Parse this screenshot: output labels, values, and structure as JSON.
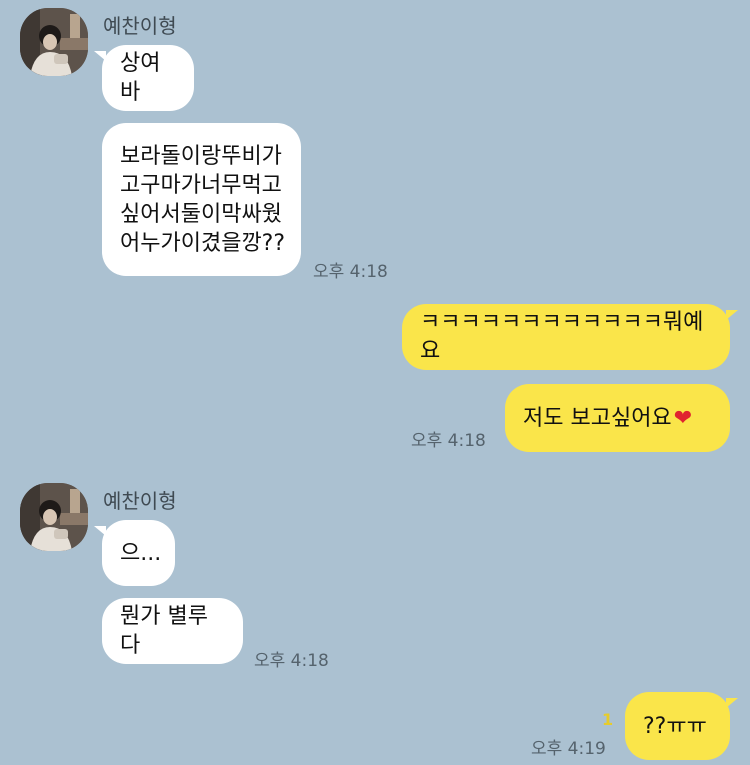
{
  "messages": {
    "sender_name": "예찬이형",
    "group1": {
      "msg1": "상여바",
      "msg2": "보라돌이랑뚜비가\n고구마가너무먹고\n싶어서둘이막싸웠\n어누가이겼을깡??",
      "time": "오후 4:18"
    },
    "mine1": {
      "msg1": "ㅋㅋㅋㅋㅋㅋㅋㅋㅋㅋㅋㅋ뭐예요",
      "msg2_text": "저도 보고싶어요",
      "msg2_emoji": "❤",
      "time": "오후 4:18"
    },
    "group2": {
      "msg1": "으...",
      "msg2": "뭔가 별루다",
      "time": "오후 4:18"
    },
    "mine2": {
      "msg1": "??ㅠㅠ",
      "unread": "1",
      "time": "오후 4:19"
    }
  },
  "colors": {
    "background": "#abc1d1",
    "incoming_bubble": "#ffffff",
    "outgoing_bubble": "#fae54a",
    "unread_count": "#e6cc2b"
  },
  "icons": {
    "avatar": "profile-photo-avatar",
    "emoji": "red-heart-emoji"
  }
}
